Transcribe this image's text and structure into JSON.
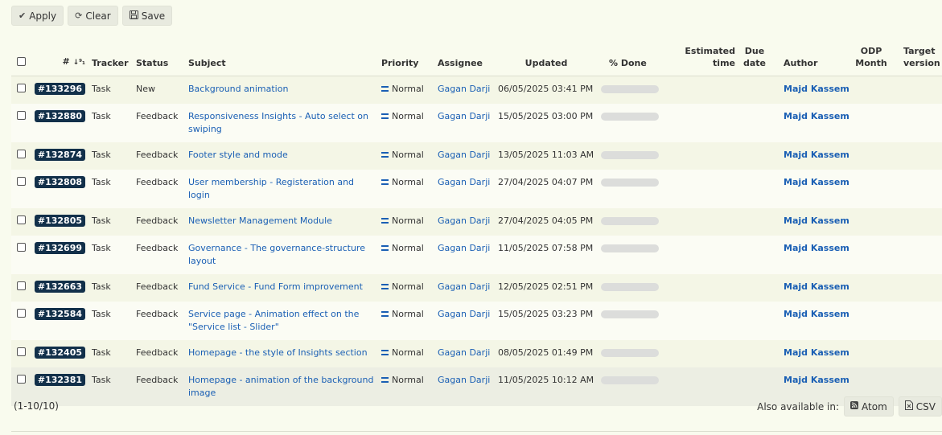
{
  "toolbar": {
    "apply_label": "Apply",
    "clear_label": "Clear",
    "save_label": "Save"
  },
  "columns": {
    "id": "#",
    "tracker": "Tracker",
    "status": "Status",
    "subject": "Subject",
    "priority": "Priority",
    "assignee": "Assignee",
    "updated": "Updated",
    "done": "% Done",
    "estimated_1": "Estimated",
    "estimated_2": "time",
    "due_1": "Due",
    "due_2": "date",
    "author": "Author",
    "odp_1": "ODP",
    "odp_2": "Month",
    "target_1": "Target",
    "target_2": "version"
  },
  "issues": [
    {
      "id": "#133296",
      "tracker": "Task",
      "status": "New",
      "subject": "Background animation",
      "priority": "Normal",
      "assignee": "Gagan Darji",
      "updated": "06/05/2025 03:41 PM",
      "done": 0,
      "author": "Majd Kassem"
    },
    {
      "id": "#132880",
      "tracker": "Task",
      "status": "Feedback",
      "subject": "Responsiveness Insights - Auto select on swiping",
      "priority": "Normal",
      "assignee": "Gagan Darji",
      "updated": "15/05/2025 03:00 PM",
      "done": 0,
      "author": "Majd Kassem"
    },
    {
      "id": "#132874",
      "tracker": "Task",
      "status": "Feedback",
      "subject": "Footer style and mode",
      "priority": "Normal",
      "assignee": "Gagan Darji",
      "updated": "13/05/2025 11:03 AM",
      "done": 0,
      "author": "Majd Kassem"
    },
    {
      "id": "#132808",
      "tracker": "Task",
      "status": "Feedback",
      "subject": "User membership - Registeration and login",
      "priority": "Normal",
      "assignee": "Gagan Darji",
      "updated": "27/04/2025 04:07 PM",
      "done": 0,
      "author": "Majd Kassem"
    },
    {
      "id": "#132805",
      "tracker": "Task",
      "status": "Feedback",
      "subject": "Newsletter Management Module",
      "priority": "Normal",
      "assignee": "Gagan Darji",
      "updated": "27/04/2025 04:05 PM",
      "done": 0,
      "author": "Majd Kassem"
    },
    {
      "id": "#132699",
      "tracker": "Task",
      "status": "Feedback",
      "subject": "Governance - The governance-structure layout",
      "priority": "Normal",
      "assignee": "Gagan Darji",
      "updated": "11/05/2025 07:58 PM",
      "done": 0,
      "author": "Majd Kassem"
    },
    {
      "id": "#132663",
      "tracker": "Task",
      "status": "Feedback",
      "subject": "Fund Service - Fund Form improvement",
      "priority": "Normal",
      "assignee": "Gagan Darji",
      "updated": "12/05/2025 02:51 PM",
      "done": 0,
      "author": "Majd Kassem"
    },
    {
      "id": "#132584",
      "tracker": "Task",
      "status": "Feedback",
      "subject": "Service page - Animation effect on the \"Service list - Slider\"",
      "priority": "Normal",
      "assignee": "Gagan Darji",
      "updated": "15/05/2025 03:23 PM",
      "done": 0,
      "author": "Majd Kassem"
    },
    {
      "id": "#132405",
      "tracker": "Task",
      "status": "Feedback",
      "subject": "Homepage - the style of Insights section",
      "priority": "Normal",
      "assignee": "Gagan Darji",
      "updated": "08/05/2025 01:49 PM",
      "done": 0,
      "author": "Majd Kassem"
    },
    {
      "id": "#132381",
      "tracker": "Task",
      "status": "Feedback",
      "subject": "Homepage - animation of the background image",
      "priority": "Normal",
      "assignee": "Gagan Darji",
      "updated": "11/05/2025 10:12 AM",
      "done": 0,
      "author": "Majd Kassem"
    }
  ],
  "pagination": "(1-10/10)",
  "formats": {
    "label": "Also available in:",
    "atom": "Atom",
    "csv": "CSV"
  },
  "icons": {
    "apply": "check-icon",
    "clear": "refresh-icon",
    "save": "floppy-icon",
    "priority": "equals-icon",
    "atom": "feed-icon",
    "csv": "spreadsheet-icon"
  },
  "colors": {
    "background": "#f9fbee",
    "id_badge": "#12304a",
    "link": "#1a5fb4"
  }
}
